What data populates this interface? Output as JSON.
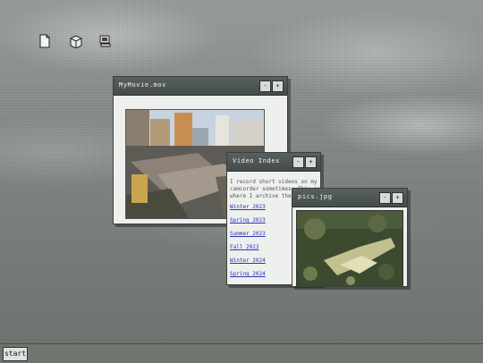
{
  "desktop": {
    "icons": [
      "document-icon",
      "package-icon",
      "computer-icon"
    ]
  },
  "windows": {
    "movie": {
      "title": "MyMovie.mov",
      "minimize_label": "-",
      "maximize_label": "+"
    },
    "index": {
      "title": "Video Index",
      "minimize_label": "-",
      "maximize_label": "+",
      "intro": "I record short videos on my camcorder sometimes. This is where I archive them f...",
      "links": [
        "Winter 2023",
        "Spring 2023",
        "Summer 2023",
        "Fall 2023",
        "Winter 2024",
        "Spring 2024"
      ]
    },
    "pics": {
      "title": "pics.jpg",
      "minimize_label": "-",
      "maximize_label": "+"
    }
  },
  "taskbar": {
    "start_label": "start"
  }
}
